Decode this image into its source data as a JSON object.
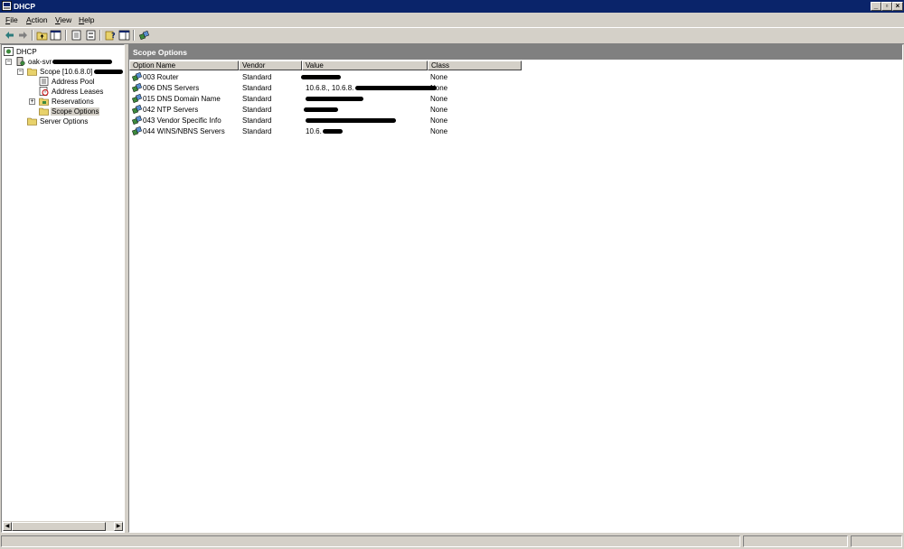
{
  "window": {
    "title": "DHCP",
    "app_icon": "mmc-console-icon"
  },
  "menu": {
    "items": [
      "File",
      "Action",
      "View",
      "Help"
    ]
  },
  "toolbar": {
    "buttons": [
      "back-arrow-icon",
      "forward-arrow-icon",
      "up-folder-icon",
      "show-hide-tree-icon",
      "properties-icon",
      "export-list-icon",
      "help-icon",
      "show-hide-action-pane-icon",
      "define-options-icon"
    ]
  },
  "tree": {
    "root": "DHCP",
    "server": "oak-svr",
    "scope": "Scope [10.6.8.0]",
    "scope_children": [
      "Address Pool",
      "Address Leases",
      "Reservations",
      "Scope Options"
    ],
    "server_options": "Server Options",
    "selected": "Scope Options"
  },
  "pane": {
    "title": "Scope Options",
    "columns": [
      "Option Name",
      "Vendor",
      "Value",
      "Class"
    ],
    "rows": [
      {
        "name": "003 Router",
        "vendor": "Standard",
        "value": "",
        "class": "None"
      },
      {
        "name": "006 DNS Servers",
        "vendor": "Standard",
        "value": "10.6.8., 10.6.8.",
        "class": "None"
      },
      {
        "name": "015 DNS Domain Name",
        "vendor": "Standard",
        "value": "",
        "class": "None"
      },
      {
        "name": "042 NTP Servers",
        "vendor": "Standard",
        "value": "",
        "class": "None"
      },
      {
        "name": "043 Vendor Specific Info",
        "vendor": "Standard",
        "value": "",
        "class": "None"
      },
      {
        "name": "044 WINS/NBNS Servers",
        "vendor": "Standard",
        "value": "10.6.",
        "class": "None"
      }
    ]
  },
  "colors": {
    "title_bar": "#0a246a",
    "face": "#d4d0c8",
    "pane_header": "#808080",
    "redaction": "#000000"
  }
}
